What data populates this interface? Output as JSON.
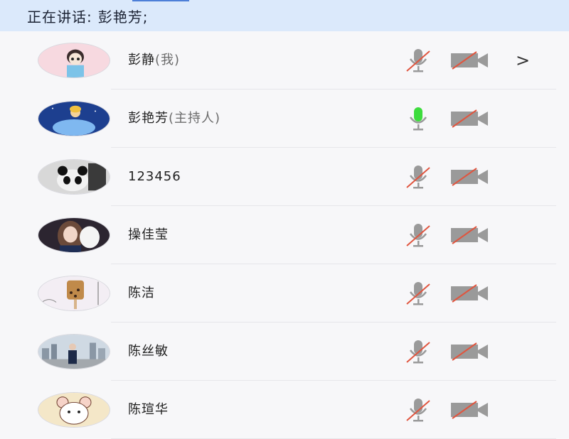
{
  "header": {
    "speaking_label": "正在讲话:",
    "speaking_names": "彭艳芳;"
  },
  "participants": [
    {
      "name": "彭静",
      "role": "(我)",
      "mic": "muted",
      "camera": "off",
      "show_more": true,
      "avatar_icon": "cartoon-girl-avatar"
    },
    {
      "name": "彭艳芳",
      "role": "(主持人)",
      "mic": "active",
      "camera": "off",
      "show_more": false,
      "avatar_icon": "cinderella-avatar"
    },
    {
      "name": "123456",
      "role": "",
      "mic": "muted",
      "camera": "off",
      "show_more": false,
      "avatar_icon": "panda-avatar"
    },
    {
      "name": "操佳莹",
      "role": "",
      "mic": "muted",
      "camera": "off",
      "show_more": false,
      "avatar_icon": "girl-photo-avatar"
    },
    {
      "name": "陈洁",
      "role": "",
      "mic": "muted",
      "camera": "off",
      "show_more": false,
      "avatar_icon": "ice-cream-avatar"
    },
    {
      "name": "陈丝敏",
      "role": "",
      "mic": "muted",
      "camera": "off",
      "show_more": false,
      "avatar_icon": "city-photo-avatar"
    },
    {
      "name": "陈瑄华",
      "role": "",
      "mic": "muted",
      "camera": "off",
      "show_more": false,
      "avatar_icon": "cartoon-mouse-avatar"
    }
  ],
  "more_glyph": ">",
  "colors": {
    "header_bg": "#dbe9fb",
    "mic_active": "#3ddc3d",
    "mic_muted": "#9a9a9a",
    "strike": "#e0553f"
  }
}
